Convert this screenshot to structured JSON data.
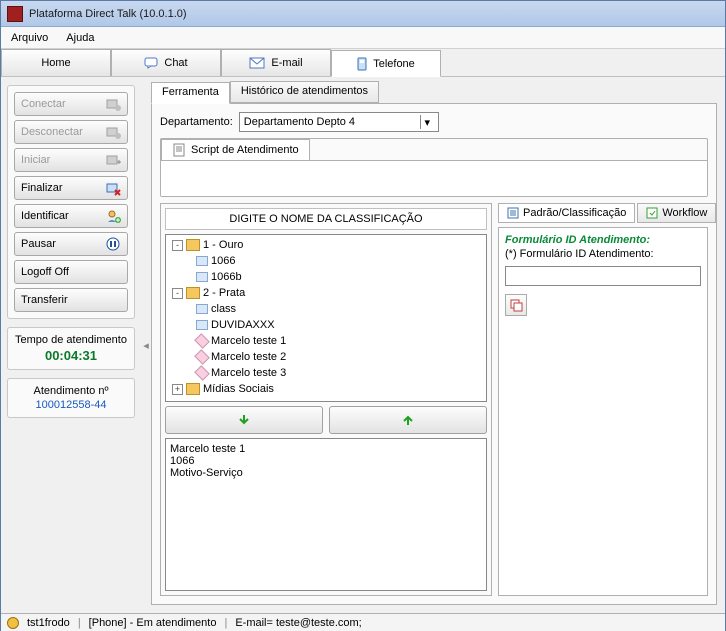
{
  "window": {
    "title": "Plataforma Direct Talk (10.0.1.0)"
  },
  "menu": {
    "arquivo": "Arquivo",
    "ajuda": "Ajuda"
  },
  "toptabs": {
    "home": "Home",
    "chat": "Chat",
    "email": "E-mail",
    "telefone": "Telefone"
  },
  "sidebar": {
    "conectar": "Conectar",
    "desconectar": "Desconectar",
    "iniciar": "Iniciar",
    "finalizar": "Finalizar",
    "identificar": "Identificar",
    "pausar": "Pausar",
    "logoff": "Logoff Off",
    "transferir": "Transferir"
  },
  "timer": {
    "label": "Tempo de atendimento",
    "value": "00:04:31"
  },
  "atend": {
    "label": "Atendimento nº",
    "value": "100012558-44"
  },
  "subtabs": {
    "ferramenta": "Ferramenta",
    "historico": "Histórico de atendimentos"
  },
  "dept": {
    "label": "Departamento:",
    "value": "Departamento Depto 4"
  },
  "script": {
    "tab": "Script de Atendimento"
  },
  "class": {
    "title": "DIGITE O NOME DA CLASSIFICAÇÃO",
    "tree": [
      {
        "level": 1,
        "exp": "-",
        "icon": "folder",
        "label": "1 - Ouro"
      },
      {
        "level": 2,
        "exp": "",
        "icon": "leaf",
        "label": "1066"
      },
      {
        "level": 2,
        "exp": "",
        "icon": "leaf",
        "label": "1066b"
      },
      {
        "level": 1,
        "exp": "-",
        "icon": "folder",
        "label": "2 - Prata"
      },
      {
        "level": 2,
        "exp": "",
        "icon": "leaf",
        "label": "class"
      },
      {
        "level": 2,
        "exp": "",
        "icon": "leaf",
        "label": "DUVIDAXXX"
      },
      {
        "level": 2,
        "exp": "",
        "icon": "pink",
        "label": "Marcelo teste 1"
      },
      {
        "level": 2,
        "exp": "",
        "icon": "pink",
        "label": "Marcelo teste 2"
      },
      {
        "level": 2,
        "exp": "",
        "icon": "pink",
        "label": "Marcelo teste 3"
      },
      {
        "level": 1,
        "exp": "+",
        "icon": "folder",
        "label": "Mídias Sociais"
      }
    ],
    "selected": [
      "Marcelo teste 1",
      "1066",
      "Motivo-Serviço"
    ]
  },
  "rightpanel": {
    "tab_padrao": "Padrão/Classificação",
    "tab_workflow": "Workflow",
    "form_title": "Formulário ID Atendimento:",
    "form_sub": "(*) Formulário ID Atendimento:"
  },
  "status": {
    "user": "tst1frodo",
    "state": "[Phone] - Em atendimento",
    "email": "E-mail= teste@teste.com;"
  }
}
